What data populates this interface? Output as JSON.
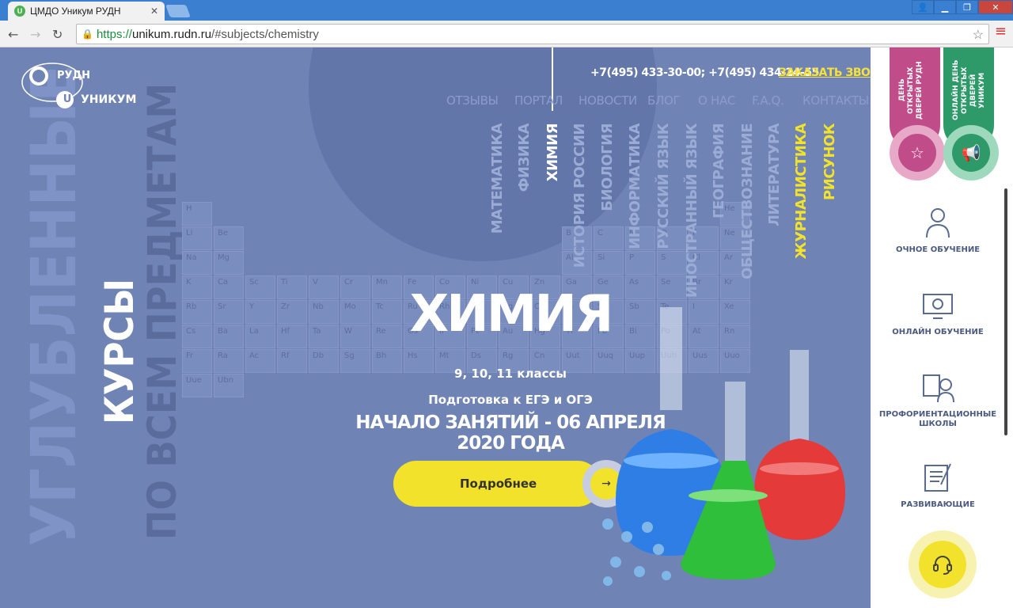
{
  "browser": {
    "tab_title": "ЦМДО Уникум РУДН",
    "favicon_letter": "U",
    "url_secure": "https://",
    "url_host": "unikum.rudn.ru",
    "url_path": "/#subjects/chemistry"
  },
  "header": {
    "logo_top": "РУДН",
    "logo_bottom": "УНИКУМ",
    "logo_letter": "U",
    "phones": "+7(495) 433-30-00; +7(495) 434-24-55",
    "callback": "ЗАКАЗАТЬ ЗВОНОК",
    "nav": [
      "ОТЗЫВЫ",
      "ПОРТАЛ",
      "НОВОСТИ",
      "БЛОГ",
      "О НАС",
      "F.A.Q.",
      "КОНТАКТЫ"
    ]
  },
  "subjects": [
    {
      "label": "МАТЕМАТИКА",
      "color": "#9aabd6"
    },
    {
      "label": "ФИЗИКА",
      "color": "#9aabd6"
    },
    {
      "label": "ХИМИЯ",
      "color": "#ffffff"
    },
    {
      "label": "ИСТОРИЯ РОССИИ",
      "color": "#9aabd6"
    },
    {
      "label": "БИОЛОГИЯ",
      "color": "#9aabd6"
    },
    {
      "label": "ИНФОРМАТИКА",
      "color": "#9aabd6"
    },
    {
      "label": "РУССКИЙ ЯЗЫК",
      "color": "#9aabd6"
    },
    {
      "label": "ИНОСТРАННЫЙ ЯЗЫК",
      "color": "#9aabd6"
    },
    {
      "label": "ГЕОГРАФИЯ",
      "color": "#9aabd6"
    },
    {
      "label": "ОБЩЕСТВОЗНАНИЕ",
      "color": "#9aabd6"
    },
    {
      "label": "ЛИТЕРАТУРА",
      "color": "#9aabd6"
    },
    {
      "label": "ЖУРНАЛИСТИКА",
      "color": "#f2e22b"
    },
    {
      "label": "РИСУНОК",
      "color": "#f2e22b"
    }
  ],
  "side_text": {
    "line1": "УГЛУБЛЕННЫЕ",
    "line2": "КУРСЫ",
    "line3": "ПО ВСЕМ ПРЕДМЕТАМ"
  },
  "hero": {
    "title": "ХИМИЯ",
    "grades": "9, 10, 11 классы",
    "prep": "Подготовка к ЕГЭ и ОГЭ",
    "start": "НАЧАЛО ЗАНЯТИЙ - 06 АПРЕЛЯ 2020 ГОДА",
    "cta": "Подробнее",
    "cta_arrow": "→"
  },
  "ribbons": [
    {
      "text": "ДЕНЬ ОТКРЫТЫХ ДВЕРЕЙ РУДН",
      "color": "#c04d8a",
      "light": "#e8a9c9",
      "icon": "star-icon"
    },
    {
      "text": "ОНЛАЙН ДЕНЬ ОТКРЫТЫХ ДВЕРЕЙ УНИКУМ",
      "color": "#2e9a6a",
      "light": "#9fd9bd",
      "icon": "megaphone-icon"
    }
  ],
  "services": [
    "ОЧНОЕ ОБУЧЕНИЕ",
    "ОНЛАЙН ОБУЧЕНИЕ",
    "ПРОФОРИЕНТАЦИОННЫЕ ШКОЛЫ",
    "РАЗВИВАЮЩИЕ"
  ],
  "elements": [
    "H",
    "",
    "",
    "",
    "",
    "",
    "",
    "",
    "",
    "",
    "",
    "",
    "",
    "",
    "",
    "",
    "",
    "He",
    "Li",
    "Be",
    "",
    "",
    "",
    "",
    "",
    "",
    "",
    "",
    "",
    "",
    "B",
    "C",
    "N",
    "O",
    "F",
    "Ne",
    "Na",
    "Mg",
    "",
    "",
    "",
    "",
    "",
    "",
    "",
    "",
    "",
    "",
    "Al",
    "Si",
    "P",
    "S",
    "Cl",
    "Ar",
    "K",
    "Ca",
    "Sc",
    "Ti",
    "V",
    "Cr",
    "Mn",
    "Fe",
    "Co",
    "Ni",
    "Cu",
    "Zn",
    "Ga",
    "Ge",
    "As",
    "Se",
    "Br",
    "Kr",
    "Rb",
    "Sr",
    "Y",
    "Zr",
    "Nb",
    "Mo",
    "Tc",
    "Ru",
    "Rh",
    "Pd",
    "Ag",
    "Cd",
    "In",
    "Sn",
    "Sb",
    "Te",
    "I",
    "Xe",
    "Cs",
    "Ba",
    "La",
    "Hf",
    "Ta",
    "W",
    "Re",
    "Os",
    "Ir",
    "Pt",
    "Au",
    "Hg",
    "Tl",
    "Pb",
    "Bi",
    "Po",
    "At",
    "Rn",
    "Fr",
    "Ra",
    "Ac",
    "Rf",
    "Db",
    "Sg",
    "Bh",
    "Hs",
    "Mt",
    "Ds",
    "Rg",
    "Cn",
    "Uut",
    "Uuq",
    "Uup",
    "Uuh",
    "Uus",
    "Uuo",
    "Uue",
    "Ubn"
  ],
  "colors": {
    "bg": "#6f83b5",
    "accent": "#f2e22b",
    "panel": "#ffffff"
  }
}
